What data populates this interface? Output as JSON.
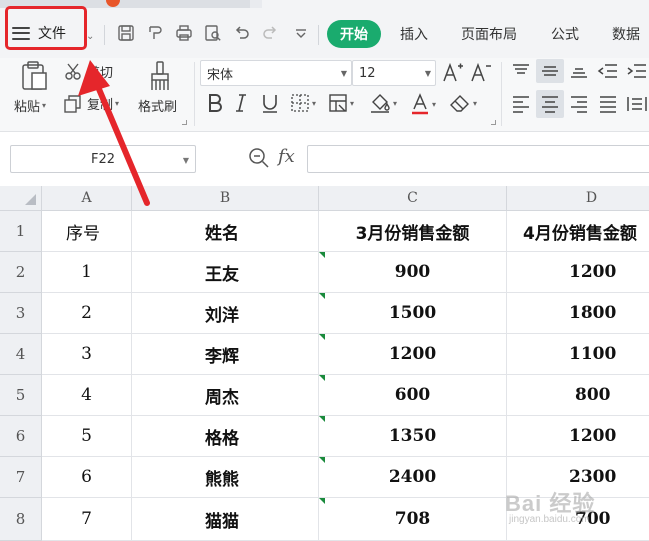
{
  "menu": {
    "file_label": "文件",
    "tabs": [
      {
        "label": "开始",
        "active": true
      },
      {
        "label": "插入",
        "active": false
      },
      {
        "label": "页面布局",
        "active": false
      },
      {
        "label": "公式",
        "active": false
      },
      {
        "label": "数据",
        "active": false
      }
    ],
    "quick_access_icons": [
      "save-icon",
      "format-painter-icon",
      "print-icon",
      "print-preview-icon",
      "undo-icon",
      "redo-icon",
      "customize-icon"
    ]
  },
  "ribbon": {
    "paste_label": "粘贴",
    "cut_label": "剪切",
    "copy_label": "复制",
    "format_painter_label": "格式刷",
    "font_name": "宋体",
    "font_size": "12"
  },
  "formula_bar": {
    "cell_ref": "F22",
    "fx_label": "fx",
    "formula": ""
  },
  "sheet": {
    "columns": [
      "A",
      "B",
      "C",
      "D"
    ],
    "rows": [
      "1",
      "2",
      "3",
      "4",
      "5",
      "6",
      "7",
      "8"
    ],
    "header": [
      "序号",
      "姓名",
      "3月份销售金额",
      "4月份销售金额"
    ],
    "data": [
      [
        "1",
        "王友",
        "900",
        "1200"
      ],
      [
        "2",
        "刘洋",
        "1500",
        "1800"
      ],
      [
        "3",
        "李辉",
        "1200",
        "1100"
      ],
      [
        "4",
        "周杰",
        "600",
        "800"
      ],
      [
        "5",
        "格格",
        "1350",
        "1200"
      ],
      [
        "6",
        "熊熊",
        "2400",
        "2300"
      ],
      [
        "7",
        "猫猫",
        "708",
        "700"
      ]
    ]
  },
  "annotation": {
    "color": "#e5262b"
  },
  "watermark": {
    "text": "Bai 经验",
    "sub": "jingyan.baidu.com"
  },
  "colors": {
    "accent": "#1aab6e",
    "annotation": "#e5262b",
    "error_flag": "#1a8a3c"
  }
}
